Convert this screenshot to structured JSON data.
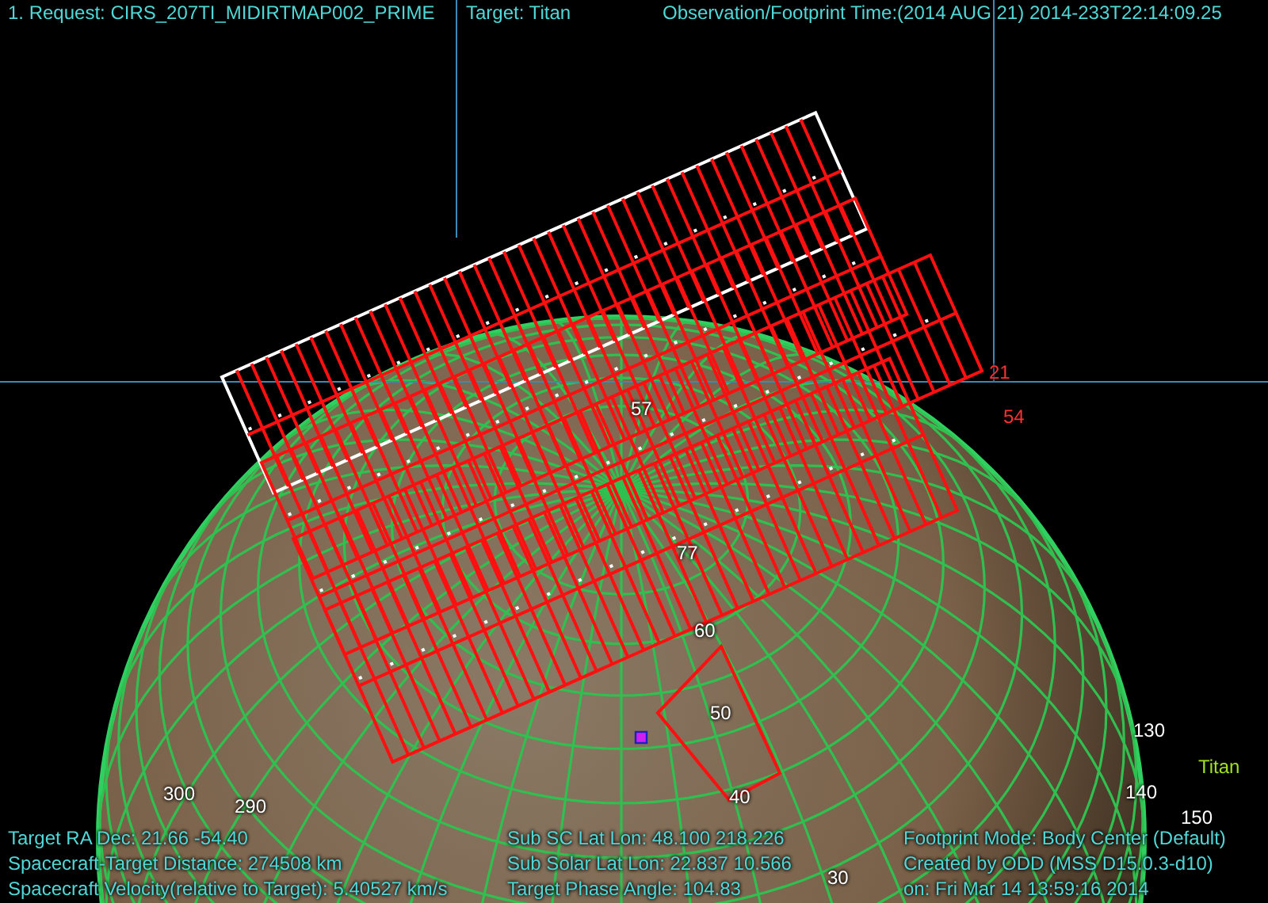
{
  "header": {
    "request": "1. Request: CIRS_207TI_MIDIRTMAP002_PRIME",
    "target": "Target: Titan",
    "time": "Observation/Footprint Time:(2014 AUG 21) 2014-233T22:14:09.25"
  },
  "labels": [
    {
      "text": "300",
      "kind": "grid"
    },
    {
      "text": "290",
      "kind": "grid"
    },
    {
      "text": "130",
      "kind": "grid"
    },
    {
      "text": "140",
      "kind": "grid"
    },
    {
      "text": "150",
      "kind": "grid"
    },
    {
      "text": "30",
      "kind": "grid"
    },
    {
      "text": "40",
      "kind": "grid"
    },
    {
      "text": "50",
      "kind": "grid"
    },
    {
      "text": "60",
      "kind": "grid"
    },
    {
      "text": "77",
      "kind": "grid"
    },
    {
      "text": "57",
      "kind": "grid"
    },
    {
      "text": "21",
      "kind": "axis"
    },
    {
      "text": "54",
      "kind": "axis"
    },
    {
      "text": "Titan",
      "kind": "body"
    }
  ],
  "info": {
    "left": [
      "Target RA Dec: 21.66  -54.40",
      "Spacecraft-Target Distance:  274508 km",
      "Spacecraft Velocity(relative to Target): 5.40527 km/s"
    ],
    "middle": [
      "Sub SC Lat Lon: 48.100  218.226",
      "Sub Solar Lat Lon: 22.837  10.566",
      "Target Phase Angle: 104.83"
    ],
    "right": [
      "Footprint Mode: Body Center (Default)",
      "Created by ODD (MSS D15.0.3-d10)",
      "on: Fri Mar 14 13:59:16 2014"
    ]
  }
}
